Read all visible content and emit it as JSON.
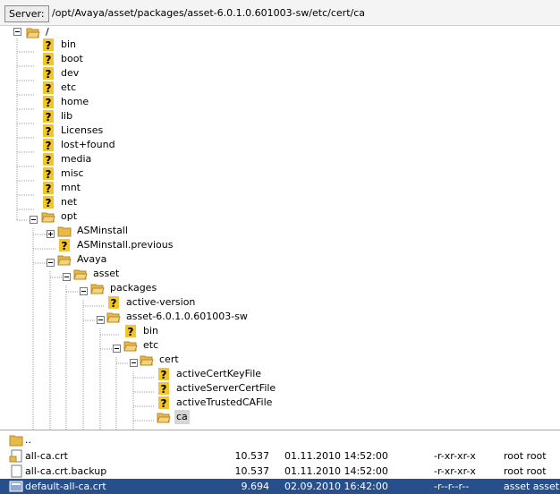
{
  "server_bar": {
    "label": "Server:",
    "path": "/opt/Avaya/asset/packages/asset-6.0.1.0.601003-sw/etc/cert/ca"
  },
  "tree": {
    "root": "/",
    "top_items": [
      "bin",
      "boot",
      "dev",
      "etc",
      "home",
      "lib",
      "Licenses",
      "lost+found",
      "media",
      "misc",
      "mnt",
      "net"
    ],
    "opt": "opt",
    "opt_children": [
      "ASMinstall",
      "ASMinstall.previous"
    ],
    "avaya": "Avaya",
    "asset": "asset",
    "packages": "packages",
    "active_version": "active-version",
    "asset_sw": "asset-6.0.1.0.601003-sw",
    "sw_bin": "bin",
    "sw_etc": "etc",
    "cert": "cert",
    "cert_files": [
      "activeCertKeyFile",
      "activeServerCertFile",
      "activeTrustedCAFile"
    ],
    "ca": "ca"
  },
  "file_list": {
    "parent": "..",
    "rows": [
      {
        "name": "all-ca.crt",
        "size": "10.537",
        "date": "01.11.2010 14:52:00",
        "perms": "-r-xr-xr-x",
        "owner": "root root"
      },
      {
        "name": "all-ca.crt.backup",
        "size": "10.537",
        "date": "01.11.2010 14:52:00",
        "perms": "-r-xr-xr-x",
        "owner": "root root"
      },
      {
        "name": "default-all-ca.crt",
        "size": "9.694",
        "date": "02.09.2010 16:42:00",
        "perms": "-r--r--r--",
        "owner": "asset asset"
      }
    ]
  },
  "colors": {
    "folder": "#e8b84a",
    "unknown_icon_bg": "#f2c52a",
    "selection": "#264f8c"
  }
}
